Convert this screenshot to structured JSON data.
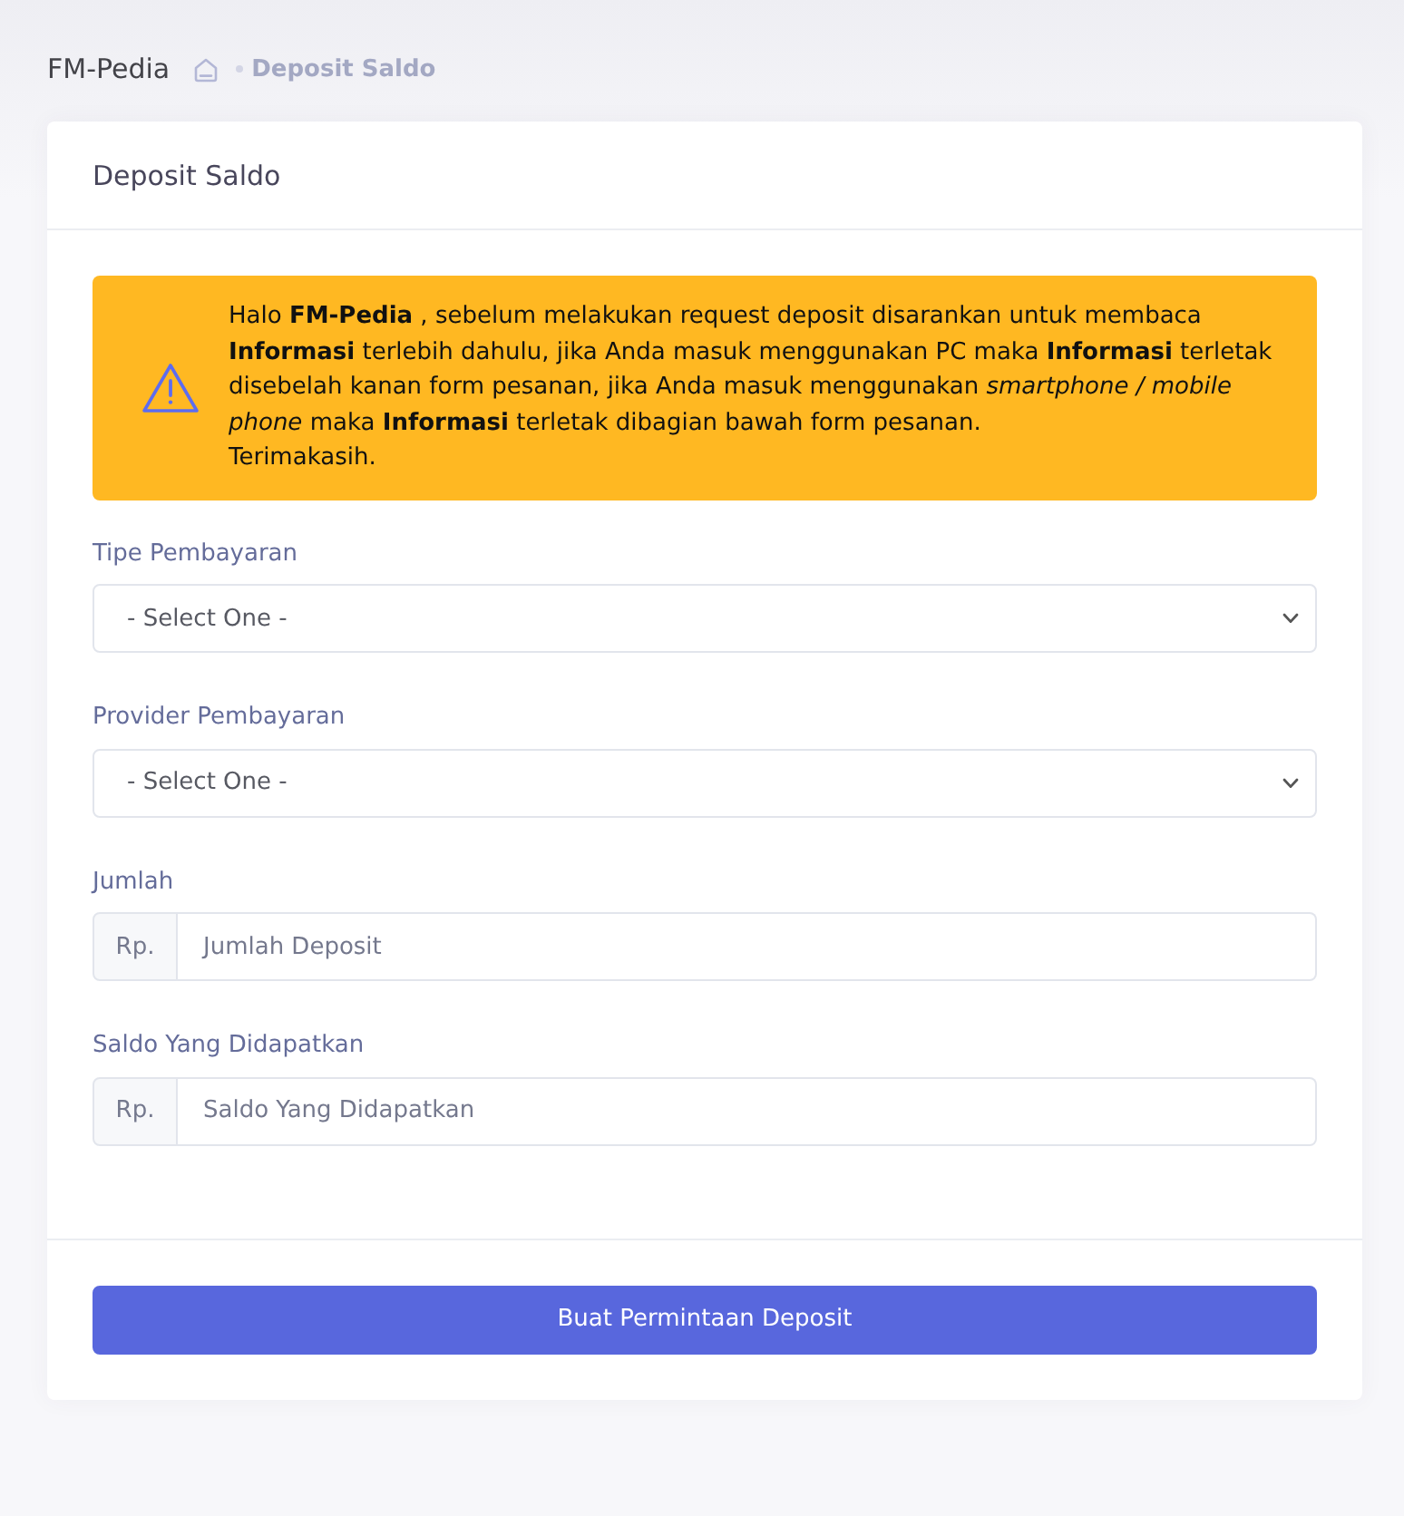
{
  "breadcrumb": {
    "title": "FM-Pedia",
    "current": "Deposit Saldo"
  },
  "card": {
    "title": "Deposit Saldo",
    "alert": {
      "message": "Halo **FM-Pedia** , sebelum melakukan request deposit disarankan untuk membaca **Informasi** terlebih dahulu, jika Anda masuk menggunakan PC maka **Informasi** terletak disebelah kanan form pesanan, jika Anda masuk menggunakan *smartphone / mobile phone* maka **Informasi** terletak dibagian bawah form pesanan.",
      "closing": "Terimakasih."
    },
    "fields": [
      {
        "kind": "select",
        "label": "Tipe Pembayaran",
        "value": "- Select One -"
      },
      {
        "kind": "select",
        "label": "Provider Pembayaran",
        "value": "- Select One -"
      },
      {
        "kind": "input",
        "label": "Jumlah",
        "prefix": "Rp.",
        "placeholder": "Jumlah Deposit"
      },
      {
        "kind": "input",
        "label": "Saldo Yang Didapatkan",
        "prefix": "Rp.",
        "placeholder": "Saldo Yang Didapatkan"
      }
    ],
    "submit": "Buat Permintaan Deposit"
  }
}
